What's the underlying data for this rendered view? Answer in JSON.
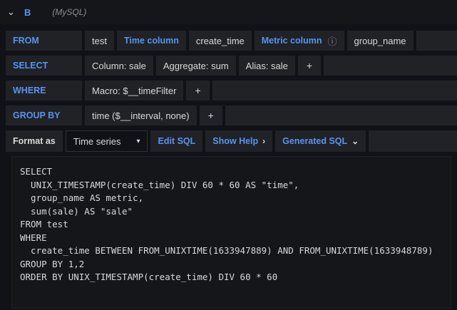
{
  "colors": {
    "accent_blue": "#5794f2",
    "segment_bg": "#202226",
    "page_bg": "#111217",
    "text": "#d8d9da"
  },
  "header": {
    "collapse_icon": "⌄",
    "ref_id": "B",
    "datasource_label": "(MySQL)"
  },
  "query_rows": {
    "from": {
      "label": "FROM",
      "table": "test",
      "time_column_label": "Time column",
      "time_column_value": "create_time",
      "metric_column_label": "Metric column",
      "info_icon": "ⓘ",
      "metric_column_value": "group_name"
    },
    "select": {
      "label": "SELECT",
      "column": "Column: sale",
      "aggregate": "Aggregate: sum",
      "alias": "Alias: sale",
      "add": "+"
    },
    "where": {
      "label": "WHERE",
      "macro": "Macro: $__timeFilter",
      "add": "+"
    },
    "group_by": {
      "label": "GROUP BY",
      "time": "time ($__interval, none)",
      "add": "+"
    }
  },
  "format_row": {
    "label": "Format as",
    "value": "Time series",
    "caret": "▾",
    "edit_sql": "Edit SQL",
    "show_help": "Show Help",
    "show_help_chevron": "›",
    "generated_sql": "Generated SQL",
    "generated_sql_chevron": "⌄"
  },
  "sql_preview": {
    "text": "SELECT\n  UNIX_TIMESTAMP(create_time) DIV 60 * 60 AS \"time\",\n  group_name AS metric,\n  sum(sale) AS \"sale\"\nFROM test\nWHERE\n  create_time BETWEEN FROM_UNIXTIME(1633947889) AND FROM_UNIXTIME(1633948789)\nGROUP BY 1,2\nORDER BY UNIX_TIMESTAMP(create_time) DIV 60 * 60"
  }
}
